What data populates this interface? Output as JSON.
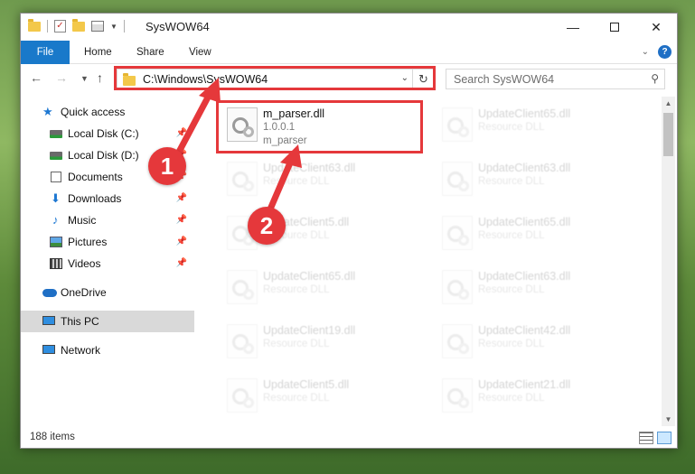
{
  "window": {
    "title": "SysWOW64",
    "minimize": "—",
    "close": "✕"
  },
  "ribbon": {
    "tabs": [
      "File",
      "Home",
      "Share",
      "View"
    ]
  },
  "nav": {
    "address": "C:\\Windows\\SysWOW64",
    "search_placeholder": "Search SysWOW64"
  },
  "sidebar": {
    "items": [
      {
        "label": "Quick access",
        "icon": "star-icon"
      },
      {
        "label": "Local Disk (C:)",
        "icon": "drive-icon",
        "pinned": true
      },
      {
        "label": "Local Disk (D:)",
        "icon": "drive-icon",
        "pinned": true
      },
      {
        "label": "Documents",
        "icon": "documents-icon",
        "pinned": true
      },
      {
        "label": "Downloads",
        "icon": "download-icon",
        "pinned": true
      },
      {
        "label": "Music",
        "icon": "music-icon",
        "pinned": true
      },
      {
        "label": "Pictures",
        "icon": "pictures-icon",
        "pinned": true
      },
      {
        "label": "Videos",
        "icon": "videos-icon",
        "pinned": true
      },
      {
        "label": "OneDrive",
        "icon": "cloud-icon"
      },
      {
        "label": "This PC",
        "icon": "pc-icon",
        "selected": true
      },
      {
        "label": "Network",
        "icon": "network-icon"
      }
    ]
  },
  "files": [
    {
      "name": "m_parser.dll",
      "line2": "1.0.0.1",
      "line3": "m_parser",
      "highlighted": true
    },
    {
      "name": "UpdateClient65.dll",
      "line2": "Resource DLL"
    },
    {
      "name": "UpdateClient63.dll",
      "line2": "Resource DLL"
    },
    {
      "name": "UpdateClient63.dll",
      "line2": "Resource DLL"
    },
    {
      "name": "UpdateClient5.dll",
      "line2": "Resource DLL"
    },
    {
      "name": "UpdateClient65.dll",
      "line2": "Resource DLL"
    },
    {
      "name": "UpdateClient65.dll",
      "line2": "Resource DLL"
    },
    {
      "name": "UpdateClient63.dll",
      "line2": "Resource DLL"
    },
    {
      "name": "UpdateClient19.dll",
      "line2": "Resource DLL"
    },
    {
      "name": "UpdateClient42.dll",
      "line2": "Resource DLL"
    },
    {
      "name": "UpdateClient5.dll",
      "line2": "Resource DLL"
    },
    {
      "name": "UpdateClient21.dll",
      "line2": "Resource DLL"
    }
  ],
  "status": {
    "count": "188 items"
  },
  "annotations": {
    "step1": "1",
    "step2": "2",
    "color": "#e5383b"
  }
}
